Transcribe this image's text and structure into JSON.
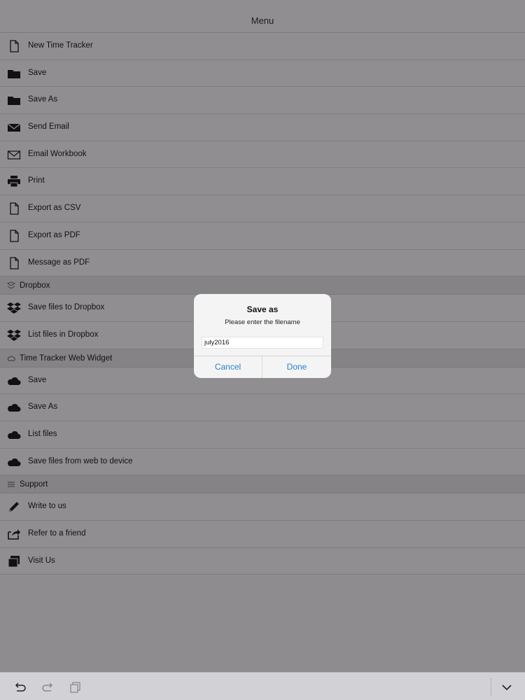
{
  "header": {
    "title": "Menu"
  },
  "file_items": [
    {
      "label": "New Time Tracker",
      "icon": "document-icon"
    },
    {
      "label": "Save",
      "icon": "folder-icon"
    },
    {
      "label": "Save As",
      "icon": "folder-icon"
    },
    {
      "label": "Send Email",
      "icon": "envelope-filled-icon"
    },
    {
      "label": "Email Workbook",
      "icon": "envelope-outline-icon"
    },
    {
      "label": "Print",
      "icon": "printer-icon"
    },
    {
      "label": "Export as CSV",
      "icon": "document-icon"
    },
    {
      "label": "Export as PDF",
      "icon": "document-icon"
    },
    {
      "label": "Message as PDF",
      "icon": "document-icon"
    }
  ],
  "sections": {
    "dropbox": {
      "title": "Dropbox",
      "icon": "dropbox-icon",
      "items": [
        {
          "label": "Save files to Dropbox",
          "icon": "dropbox-icon"
        },
        {
          "label": "List files in Dropbox",
          "icon": "dropbox-icon"
        }
      ]
    },
    "web_widget": {
      "title": "Time Tracker Web Widget",
      "icon": "cloud-outline-icon",
      "items": [
        {
          "label": "Save",
          "icon": "cloud-icon"
        },
        {
          "label": "Save As",
          "icon": "cloud-icon"
        },
        {
          "label": "List files",
          "icon": "cloud-icon"
        },
        {
          "label": "Save files from web to device",
          "icon": "cloud-icon"
        }
      ]
    },
    "support": {
      "title": "Support",
      "icon": "list-lines-icon",
      "items": [
        {
          "label": "Write to us",
          "icon": "pencil-icon"
        },
        {
          "label": "Refer to a friend",
          "icon": "share-icon"
        },
        {
          "label": "Visit Us",
          "icon": "windows-icon"
        }
      ]
    }
  },
  "dialog": {
    "title": "Save as",
    "message": "Please enter the filename",
    "input_value": "july2016",
    "cancel_label": "Cancel",
    "done_label": "Done"
  },
  "toolbar": {
    "icons": [
      "undo-icon",
      "redo-icon",
      "paste-icon",
      "chevron-down-icon"
    ]
  },
  "colors": {
    "accent": "#2c7fd1",
    "dim_background": "#8e8c8f",
    "toolbar_bg": "#d2d2d6"
  }
}
